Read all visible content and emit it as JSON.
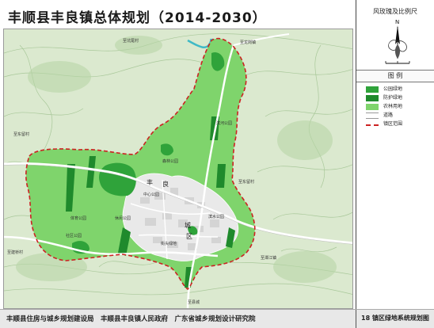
{
  "title": "丰顺县丰良镇总体规划（2014-2030）",
  "side_panel": {
    "compass_heading": "风玫瑰及比例尺",
    "north_letter": "N",
    "legend_heading": "图 例",
    "legend_items": [
      {
        "label": "公园绿地",
        "color": "#2fa33a",
        "kind": "fill"
      },
      {
        "label": "防护绿地",
        "color": "#1f8a2c",
        "kind": "fill"
      },
      {
        "label": "农林用地",
        "color": "#7fd46c",
        "kind": "fill"
      },
      {
        "label": "道路",
        "color": "#ffffff",
        "kind": "road"
      },
      {
        "label": "镇区范围",
        "color": "#cc2222",
        "kind": "dash"
      }
    ]
  },
  "map_labels": {
    "big_1": "丰",
    "big_2": "良",
    "big_3": "城",
    "big_4": "区",
    "place_1": "至东留村",
    "place_2": "至龙岗镇",
    "place_3": "至坑尾村",
    "place_4": "至建桥村",
    "place_5": "至潭江镇",
    "place_6": "至县城",
    "place_7": "至东留村",
    "park_1": "滨河公园",
    "park_2": "森林公园",
    "park_3": "中心公园",
    "park_4": "体育公园",
    "park_5": "休闲公园",
    "park_6": "滨水公园",
    "park_7": "街头绿地",
    "park_8": "社区公园"
  },
  "footer": {
    "credits": "丰顺县住房与城乡规划建设局　丰顺县丰良镇人民政府　广东省城乡规划设计研究院",
    "sheet": "18 镇区绿地系统规划图"
  }
}
